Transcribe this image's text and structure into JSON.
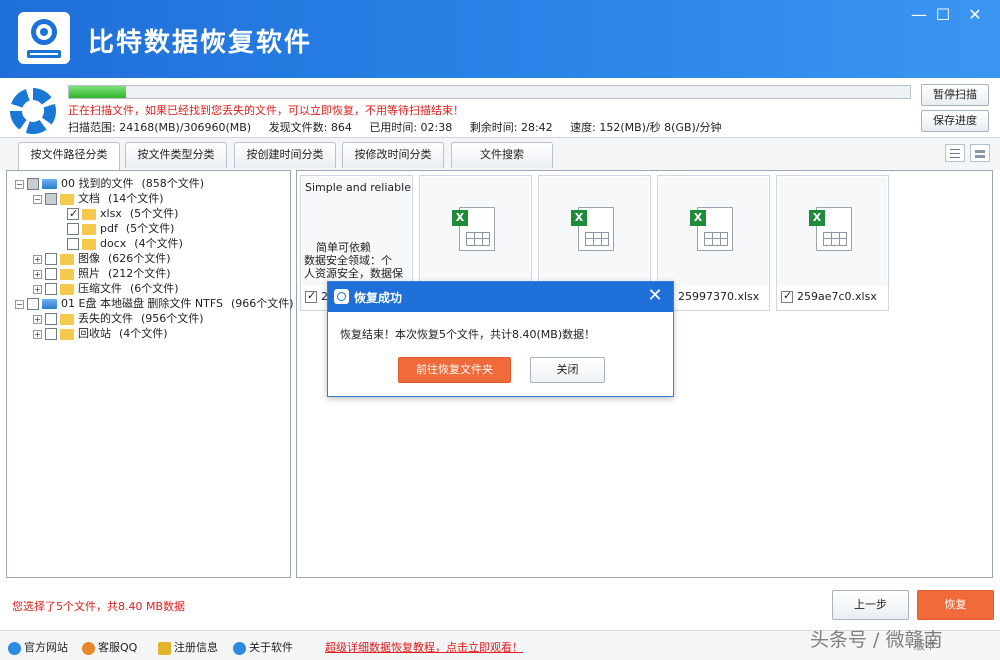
{
  "app": {
    "title": "比特数据恢复软件"
  },
  "window_controls": {
    "minimize": "—",
    "maximize": "☐",
    "close": "✕"
  },
  "scan": {
    "progress_fraction": 0.068,
    "message": "正在扫描文件，如果已经找到您丢失的文件，可以立即恢复，不用等待扫描结束！",
    "range": "扫描范围: 24168(MB)/306960(MB)",
    "found": "发现文件数: 864",
    "elapsed": "已用时间: 02:38",
    "remaining": "剩余时间: 28:42",
    "speed": "速度: 152(MB)/秒  8(GB)/分钟",
    "pause_label": "暂停扫描",
    "save_label": "保存进度"
  },
  "tabs": [
    {
      "label": "按文件路径分类"
    },
    {
      "label": "按文件类型分类"
    },
    {
      "label": "按创建时间分类"
    },
    {
      "label": "按修改时间分类"
    },
    {
      "label": "文件搜索"
    }
  ],
  "tree": [
    {
      "label": "00 找到的文件",
      "count": "(858个文件)"
    },
    {
      "label": "文档",
      "count": "(14个文件)"
    },
    {
      "label": "xlsx",
      "count": "(5个文件)"
    },
    {
      "label": "pdf",
      "count": "(5个文件)"
    },
    {
      "label": "docx",
      "count": "(4个文件)"
    },
    {
      "label": "图像",
      "count": "(626个文件)"
    },
    {
      "label": "照片",
      "count": "(212个文件)"
    },
    {
      "label": "压缩文件",
      "count": "(6个文件)"
    },
    {
      "label": "01 E盘 本地磁盘 删除文件 NTFS",
      "count": "(966个文件)"
    },
    {
      "label": "丢失的文件",
      "count": "(956个文件)"
    },
    {
      "label": "回收站",
      "count": "(4个文件)"
    }
  ],
  "files": [
    {
      "name": "2",
      "preview": [
        "Simple and reliable",
        "简单可依赖",
        "数据安全领域：个",
        "人资源安全，数据保"
      ]
    },
    {
      "name": ""
    },
    {
      "name": ""
    },
    {
      "name": "25997370.xlsx"
    },
    {
      "name": "259ae7c0.xlsx"
    }
  ],
  "dialog": {
    "title": "恢复成功",
    "close": "✕",
    "message": "恢复结束！本次恢复5个文件，共计8.40(MB)数据！",
    "open_folder_label": "前往恢复文件夹",
    "close_label": "关闭"
  },
  "status": {
    "selected": "您选择了5个文件，共8.40 MB数据"
  },
  "nav": {
    "prev_label": "上一步",
    "recover_label": "恢复"
  },
  "footer": {
    "website": "官方网站",
    "qq": "客服QQ",
    "register": "注册信息",
    "about": "关于软件",
    "promo": "超级详细数据恢复教程，点击立即观看！",
    "version": "版本"
  },
  "watermark": "头条号 / 微赣南",
  "colors": {
    "accent": "#1f6fd8",
    "danger": "#e11d1d",
    "action": "#f06a3a"
  }
}
